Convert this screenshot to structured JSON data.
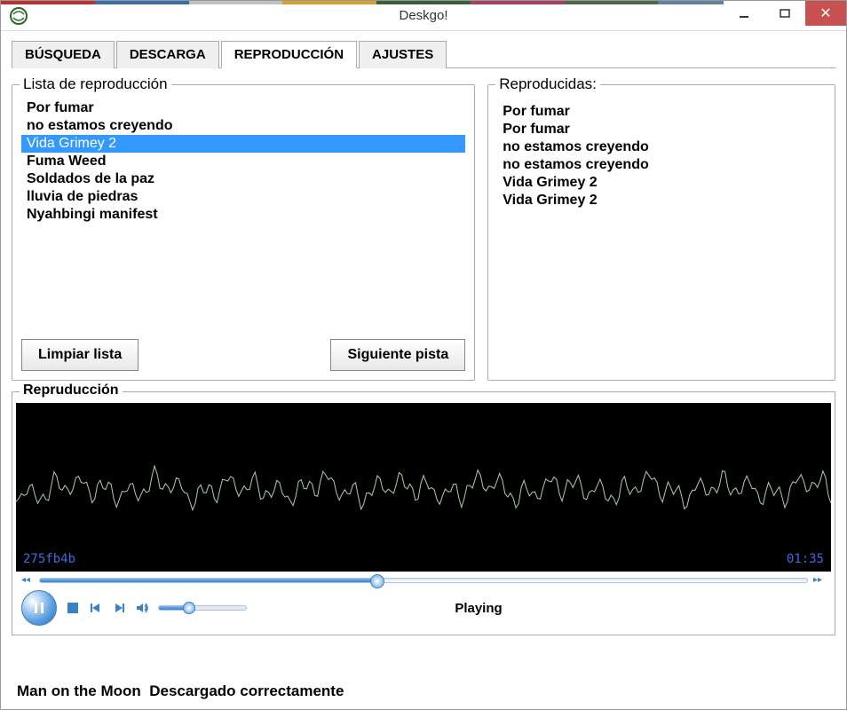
{
  "window": {
    "title": "Deskgo!"
  },
  "tabs": [
    {
      "label": "BÚSQUEDA",
      "active": false
    },
    {
      "label": "DESCARGA",
      "active": false
    },
    {
      "label": "REPRODUCCIÓN",
      "active": true
    },
    {
      "label": "AJUSTES",
      "active": false
    }
  ],
  "playlist": {
    "title": "Lista de reproducción",
    "items": [
      {
        "label": "Por fumar",
        "selected": false
      },
      {
        "label": "no estamos creyendo",
        "selected": false
      },
      {
        "label": "Vida Grimey 2",
        "selected": true
      },
      {
        "label": "Fuma Weed",
        "selected": false
      },
      {
        "label": "Soldados de la paz",
        "selected": false
      },
      {
        "label": "lluvia de piedras",
        "selected": false
      },
      {
        "label": "Nyahbingi manifest",
        "selected": false
      }
    ],
    "clear_btn": "Limpiar lista",
    "next_btn": "Siguiente pista"
  },
  "history": {
    "title": "Reproducidas:",
    "items": [
      "Por fumar",
      "Por fumar",
      "no estamos creyendo",
      "no estamos creyendo",
      "Vida Grimey 2",
      "Vida Grimey 2"
    ]
  },
  "player": {
    "title": "Repruducción",
    "wave_id": "275fb4b",
    "time": "01:35",
    "status": "Playing"
  },
  "statusbar": {
    "track": "Man on the Moon",
    "msg": "Descargado correctamente"
  },
  "titlebar_colors": [
    "#be2f2f",
    "#3a6ea5",
    "#c0c0c0",
    "#d8a030",
    "#3a5f3a",
    "#a84060",
    "#4a6a4a",
    "#6080a0",
    "#808080"
  ]
}
